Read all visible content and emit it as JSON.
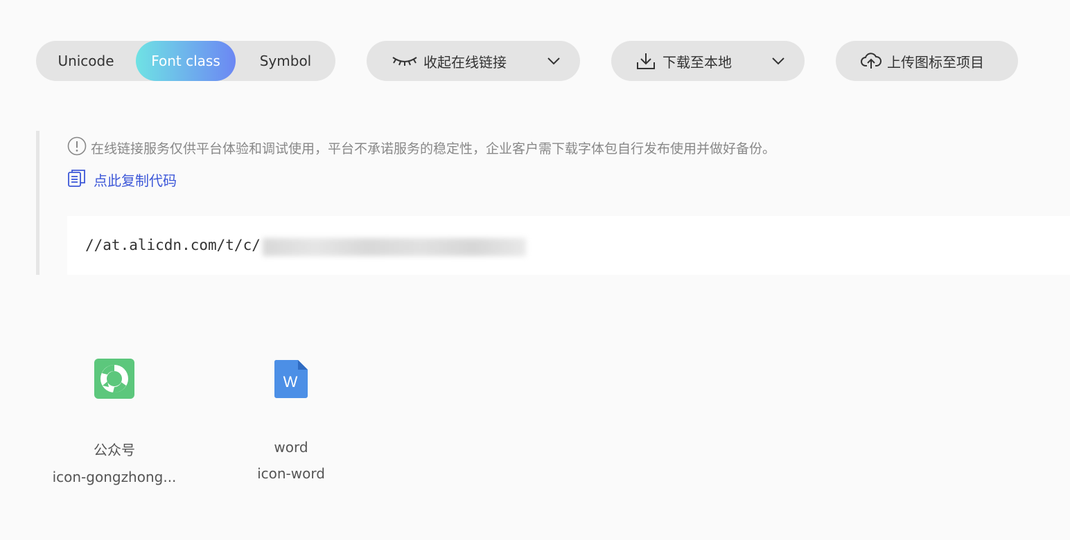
{
  "tabs": {
    "items": [
      "Unicode",
      "Font class",
      "Symbol"
    ],
    "active_index": 1
  },
  "actions": {
    "collapse_label": "收起在线链接",
    "download_label": "下载至本地",
    "upload_label": "上传图标至项目"
  },
  "info": {
    "notice": "在线链接服务仅供平台体验和调试使用，平台不承诺服务的稳定性，企业客户需下载字体包自行发布使用并做好备份。",
    "copy_label": "点此复制代码",
    "code_url": "//at.alicdn.com/t/c/"
  },
  "icons": [
    {
      "name": "公众号",
      "class": "icon-gongzhong...",
      "icon": "wechat-official-account-icon",
      "color": "#5cc77c"
    },
    {
      "name": "word",
      "class": "icon-word",
      "icon": "word-document-icon",
      "color": "#4c8fe6"
    }
  ],
  "colors": {
    "accent_start": "#6fe2e4",
    "accent_end": "#6c87f3",
    "link": "#3c57d8"
  }
}
